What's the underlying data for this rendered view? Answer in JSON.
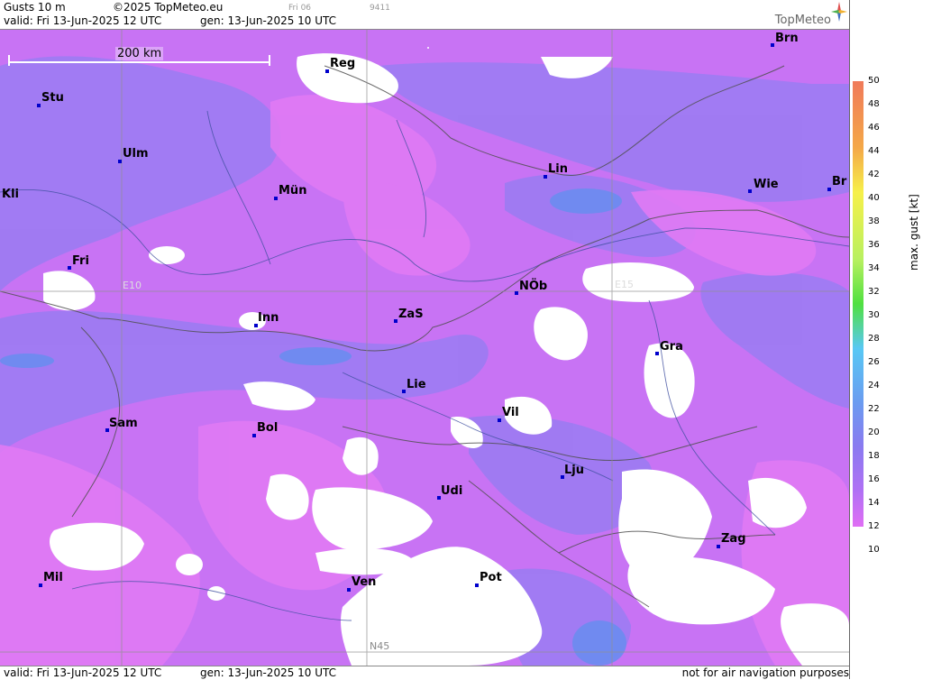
{
  "header": {
    "title": "Gusts 10 m",
    "copyright": "©2025 TopMeteo.eu",
    "valid": "valid:  Fri  13-Jun-2025  12 UTC",
    "gen": "gen: 13-Jun-2025 10 UTC",
    "small_day": "Fri 06",
    "small_code": "9411",
    "brand": "TopMeteo"
  },
  "map": {
    "scale_label": "200 km",
    "grid_labels": {
      "e10": "E10",
      "e15": "E15",
      "n45": "N45"
    },
    "cities": [
      {
        "name": "Brn"
      },
      {
        "name": "Reg"
      },
      {
        "name": "Stu"
      },
      {
        "name": "Ulm"
      },
      {
        "name": "Kli"
      },
      {
        "name": "Mün"
      },
      {
        "name": "Lin"
      },
      {
        "name": "Wie"
      },
      {
        "name": "Br"
      },
      {
        "name": "Fri"
      },
      {
        "name": "NÖb"
      },
      {
        "name": "Inn"
      },
      {
        "name": "ZaS"
      },
      {
        "name": "Gra"
      },
      {
        "name": "Lie"
      },
      {
        "name": "Vil"
      },
      {
        "name": "Sam"
      },
      {
        "name": "Bol"
      },
      {
        "name": "Lju"
      },
      {
        "name": "Udi"
      },
      {
        "name": "Zag"
      },
      {
        "name": "Mil"
      },
      {
        "name": "Ven"
      },
      {
        "name": "Pot"
      }
    ]
  },
  "legend": {
    "units": "max. gust  [kt]",
    "ticks": [
      "50",
      "48",
      "46",
      "44",
      "42",
      "40",
      "38",
      "36",
      "34",
      "32",
      "30",
      "28",
      "26",
      "24",
      "22",
      "20",
      "18",
      "16",
      "14",
      "12",
      "10"
    ],
    "colors": {
      "50": "#f07a5a",
      "44": "#f4a848",
      "40": "#f6f04a",
      "34": "#b8f060",
      "30": "#50e040",
      "26": "#58c8f4",
      "22": "#6a9cf0",
      "18": "#8a7af0",
      "14": "#b070f4",
      "12": "#e06ef4"
    }
  },
  "footer": {
    "valid": "valid:  Fri  13-Jun-2025  12 UTC",
    "gen": "gen: 13-Jun-2025 10 UTC",
    "note": "not for air navigation purposes"
  }
}
